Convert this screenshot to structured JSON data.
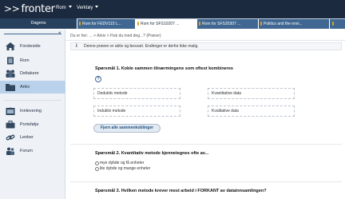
{
  "header": {
    "logo": "fronter",
    "menus": [
      "Rom",
      "Verktøy"
    ]
  },
  "tabs": {
    "home": "Dagens",
    "rooms": [
      "Rom for FEDV115 L...",
      "Rom for SFS10207 ...",
      "Rom for SFS20307 ...",
      "Politics and the envi..."
    ]
  },
  "sidebar": {
    "items": [
      {
        "label": "Forsteside",
        "icon": "home-icon"
      },
      {
        "label": "Rom",
        "icon": "room-icon"
      },
      {
        "label": "Deltakere",
        "icon": "participants-icon"
      },
      {
        "label": "Arkiv",
        "icon": "folder-icon"
      },
      {
        "label": "Innlevering",
        "icon": "submission-icon"
      },
      {
        "label": "Portefølje",
        "icon": "portfolio-icon"
      },
      {
        "label": "Lenker",
        "icon": "link-icon"
      },
      {
        "label": "Forum",
        "icon": "forum-icon"
      }
    ],
    "active_index": 3
  },
  "breadcrumb": "Du er her: ... > Arkiv > Fisk du med deg...? (Prøver)",
  "notice": {
    "icon": "i",
    "text": "Denne prøven er aktiv og besvart. Endringer er derfor ikke mulig."
  },
  "questions": {
    "q1": {
      "title": "Spørsmål 1. Koble sammen tilnærmingene som oftest kombineres",
      "help": "?",
      "left": [
        "Deduktiv metode",
        "Induktiv metode"
      ],
      "right": [
        "Kvantitative data",
        "Kvalitative data"
      ],
      "clear_button": "Fjern alle sammenkoblinger"
    },
    "q2": {
      "title": "Spørsmål 2. Kvantitativ metode kjennetegnes ofte av...",
      "options": [
        "mye dybde og få enheter",
        "lite dybde og mange enheter"
      ]
    },
    "q3": {
      "title": "Spørsmål 3. Hvilken metode krever mest arbeid i FORKANT av datainnsamlingen?"
    }
  },
  "colors": {
    "topbar": "#1c2a3f",
    "tab_blue": "#3f6791",
    "active_nav": "#b9d1ea",
    "tab_pin": "#e4a21b"
  }
}
